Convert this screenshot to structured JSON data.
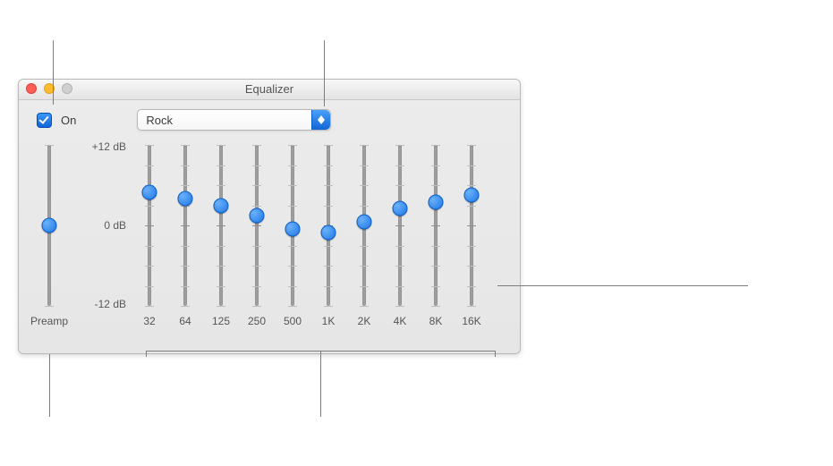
{
  "window": {
    "title": "Equalizer"
  },
  "controls": {
    "on_checkbox_checked": true,
    "on_label": "On",
    "preset_popup_value": "Rock"
  },
  "scale": {
    "top": "+12 dB",
    "mid": "0 dB",
    "bottom": "-12 dB"
  },
  "preamp": {
    "label": "Preamp",
    "value_db": 0
  },
  "bands": [
    {
      "freq_label": "32",
      "value_db": 5.0
    },
    {
      "freq_label": "64",
      "value_db": 4.0
    },
    {
      "freq_label": "125",
      "value_db": 3.0
    },
    {
      "freq_label": "250",
      "value_db": 1.5
    },
    {
      "freq_label": "500",
      "value_db": -0.5
    },
    {
      "freq_label": "1K",
      "value_db": -1.0
    },
    {
      "freq_label": "2K",
      "value_db": 0.5
    },
    {
      "freq_label": "4K",
      "value_db": 2.5
    },
    {
      "freq_label": "8K",
      "value_db": 3.5
    },
    {
      "freq_label": "16K",
      "value_db": 4.5
    }
  ],
  "slider_range_db": {
    "min": -12,
    "max": 12
  },
  "colors": {
    "accent": "#1e78e6",
    "track": "#9d9d9d",
    "window_bg": "#e9e9e9"
  }
}
